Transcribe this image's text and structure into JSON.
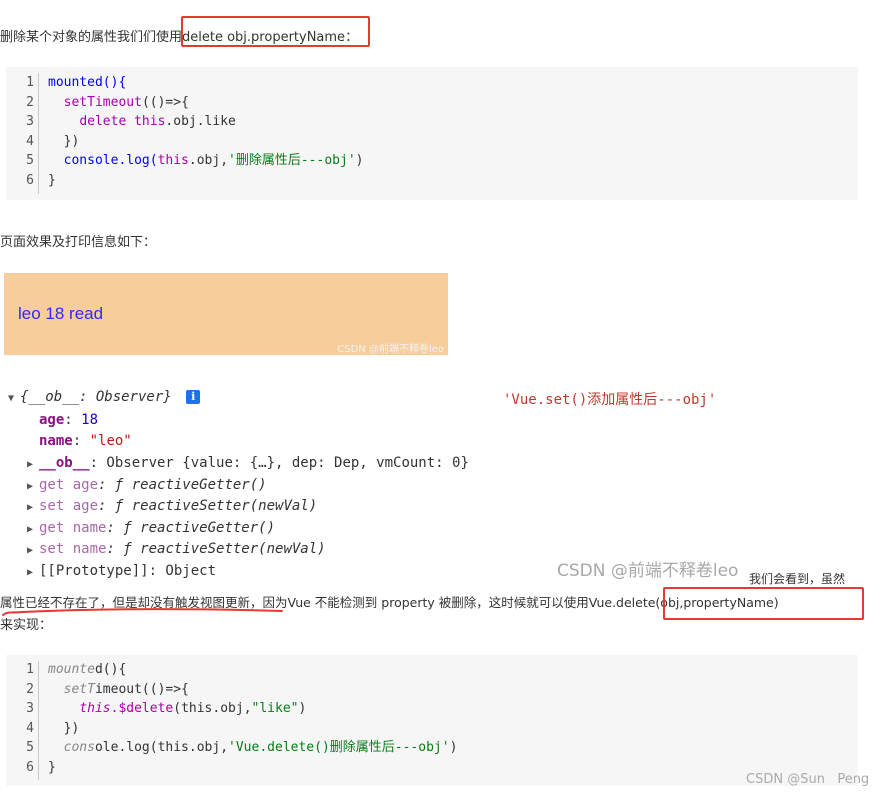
{
  "para1": {
    "prefix": "删除某个对象的属性我们们使用",
    "highlight": "delete obj.propertyName",
    "suffix": "："
  },
  "code1": {
    "line_numbers": [
      "1",
      "2",
      "3",
      "4",
      "5",
      "6"
    ],
    "l1": "mounted(){",
    "l2_fn": "setTimeout",
    "l2_rest": "(()=>{",
    "l3_kw": "delete",
    "l3_this": "this",
    "l3_rest": ".obj.like",
    "l4": "})",
    "l5_a": "console.log(",
    "l5_this": "this",
    "l5_b": ".obj,",
    "l5_str": "'删除属性后---obj'",
    "l5_c": ")",
    "l6": "}"
  },
  "para2": "页面效果及打印信息如下：",
  "preview": {
    "text": "leo 18 read",
    "watermark": "CSDN @前端不释卷leo",
    "bg": "#f7ce9b",
    "text_color": "#2a2aff"
  },
  "console": {
    "header": "{__ob__: Observer}",
    "info_icon": "i",
    "annotation": "'Vue.set()添加属性后---obj'",
    "age_key": "age",
    "age_sep": ":",
    "age_val": "18",
    "name_key": "name",
    "name_sep": ":",
    "name_val": "\"leo\"",
    "ob_key": "__ob__",
    "ob_val": ": Observer {value: {…}, dep: Dep, vmCount: 0}",
    "get_age": "get age",
    "get_age_val": ": ƒ reactiveGetter()",
    "set_age": "set age",
    "set_age_val": ": ƒ reactiveSetter(newVal)",
    "get_name": "get name",
    "get_name_val": ": ƒ reactiveGetter()",
    "set_name": "set name",
    "set_name_val": ": ƒ reactiveSetter(newVal)",
    "proto": "[[Prototype]]: Object",
    "watermark": "CSDN @前端不释卷leo"
  },
  "para3": {
    "lead": "我们会看到，虽然",
    "underlined": "属性已经不存在了，但是却没有触发视图更新",
    "mid": "，因为Vue 不能检测到 property 被删除，这时候就可以使用",
    "highlight": "Vue.delete(obj,propertyName)",
    "tail": "来实现："
  },
  "code2": {
    "line_numbers": [
      "1",
      "2",
      "3",
      "4",
      "5",
      "6"
    ],
    "l1_it": "mounte",
    "l1_rest": "d(){",
    "l2_it": "setT",
    "l2_rest": "imeout(()=>{",
    "l3_it": "this",
    "l3_fn": ".$delete",
    "l3_a": "(this.obj,",
    "l3_str": "\"like\"",
    "l3_b": ")",
    "l4": "})",
    "l5_it": "cons",
    "l5_a": "ole.log(this.obj,",
    "l5_str": "'Vue.delete()删除属性后---obj'",
    "l5_b": ")",
    "l6": "}"
  },
  "footer_watermark": "CSDN @Sun   Peng",
  "colors": {
    "highlight_box": "#e53935",
    "code_bg": "#f6f6f6",
    "info_icon": "#1a73e8"
  }
}
